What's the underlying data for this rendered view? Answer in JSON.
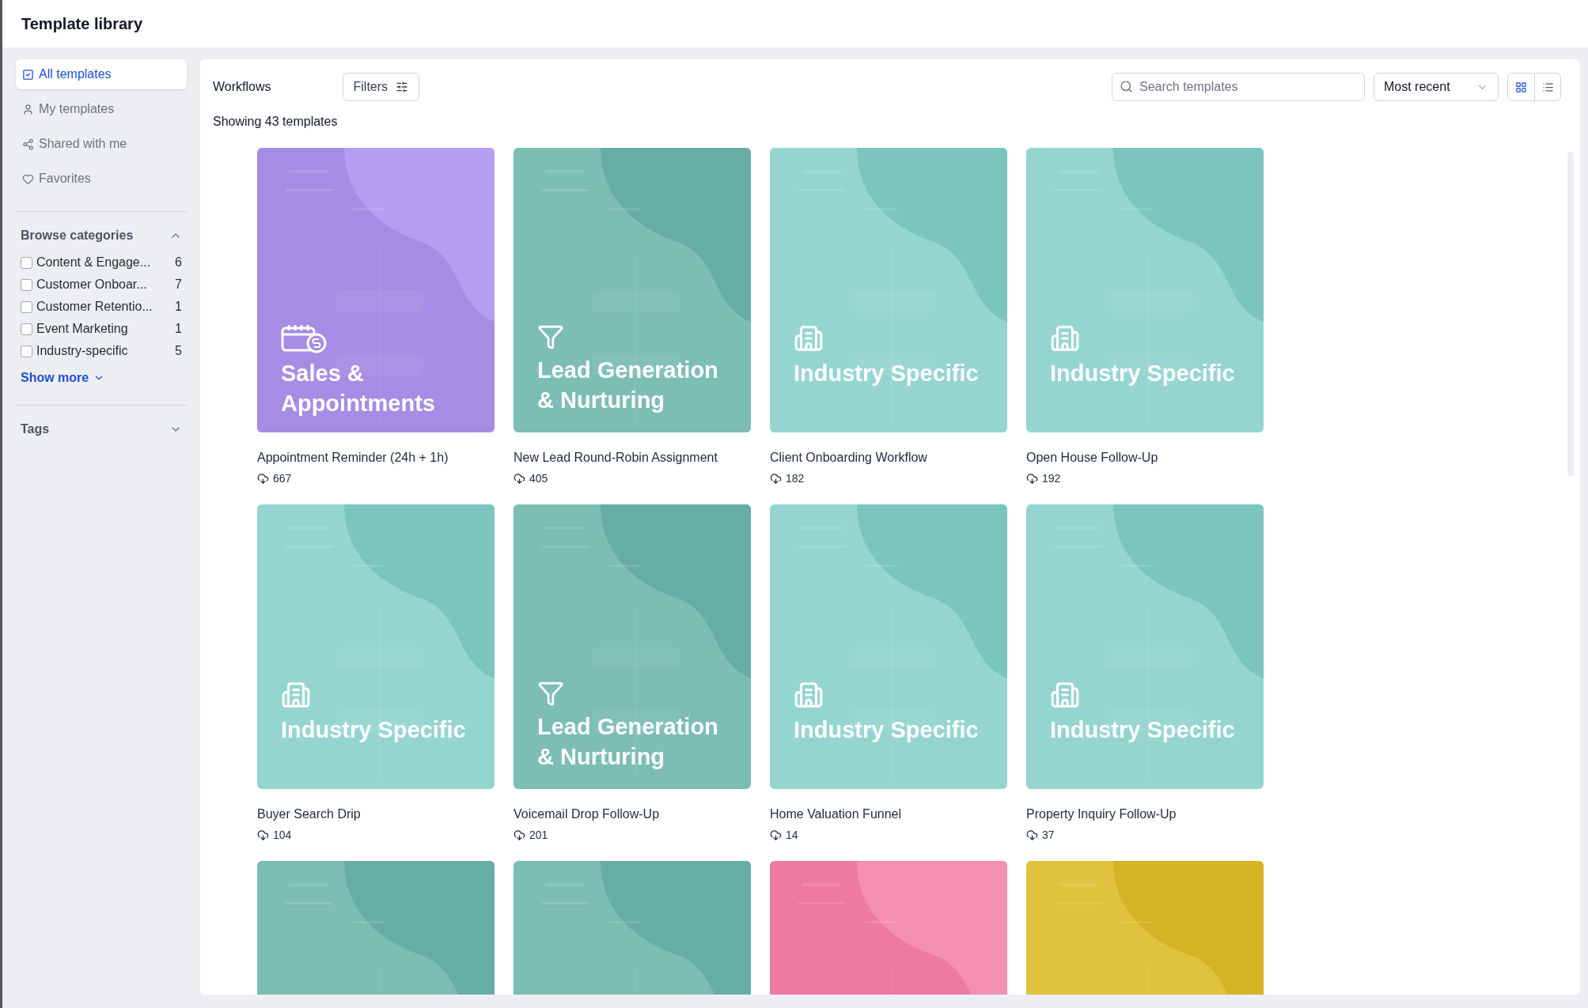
{
  "window": {
    "title": "Template library"
  },
  "sidebar": {
    "nav": [
      {
        "label": "All templates",
        "selected": true
      },
      {
        "label": "My templates",
        "selected": false
      },
      {
        "label": "Shared with me",
        "selected": false
      },
      {
        "label": "Favorites",
        "selected": false
      }
    ],
    "categories": {
      "title": "Browse categories",
      "expanded": true,
      "items": [
        {
          "label": "Content & Engage...",
          "count": "6",
          "checked": false
        },
        {
          "label": "Customer Onboar...",
          "count": "7",
          "checked": false
        },
        {
          "label": "Customer Retentio...",
          "count": "1",
          "checked": false
        },
        {
          "label": "Event Marketing",
          "count": "1",
          "checked": false
        },
        {
          "label": "Industry-specific",
          "count": "5",
          "checked": false
        }
      ],
      "show_more": "Show more"
    },
    "tags": {
      "title": "Tags",
      "expanded": false
    }
  },
  "toolbar": {
    "section": "Workflows",
    "filters": "Filters",
    "search": {
      "placeholder": "Search templates"
    },
    "sort": "Most recent",
    "views": [
      {
        "kind": "grid",
        "selected": true
      },
      {
        "kind": "list",
        "selected": false
      }
    ]
  },
  "summary": "Showing 43 templates",
  "templates": [
    {
      "kind": "sales",
      "cover_title": "Sales & Appointments",
      "name": "Appointment Reminder (24h + 1h)",
      "downloads": "667"
    },
    {
      "kind": "lead",
      "cover_title": "Lead Generation & Nurturing",
      "name": "New Lead Round-Robin Assignment",
      "downloads": "405"
    },
    {
      "kind": "industry",
      "cover_title": "Industry Specific",
      "name": "Client Onboarding Workflow",
      "downloads": "182"
    },
    {
      "kind": "industry",
      "cover_title": "Industry Specific",
      "name": "Open House Follow-Up",
      "downloads": "192"
    },
    {
      "kind": "industry",
      "cover_title": "Industry Specific",
      "name": "Buyer Search Drip",
      "downloads": "104"
    },
    {
      "kind": "lead",
      "cover_title": "Lead Generation & Nurturing",
      "name": "Voicemail Drop Follow-Up",
      "downloads": "201"
    },
    {
      "kind": "industry",
      "cover_title": "Industry Specific",
      "name": "Home Valuation Funnel",
      "downloads": "14"
    },
    {
      "kind": "industry",
      "cover_title": "Industry Specific",
      "name": "Property Inquiry Follow-Up",
      "downloads": "37"
    },
    {
      "kind": "lead"
    },
    {
      "kind": "lead"
    },
    {
      "kind": "pink"
    },
    {
      "kind": "yellow"
    }
  ]
}
